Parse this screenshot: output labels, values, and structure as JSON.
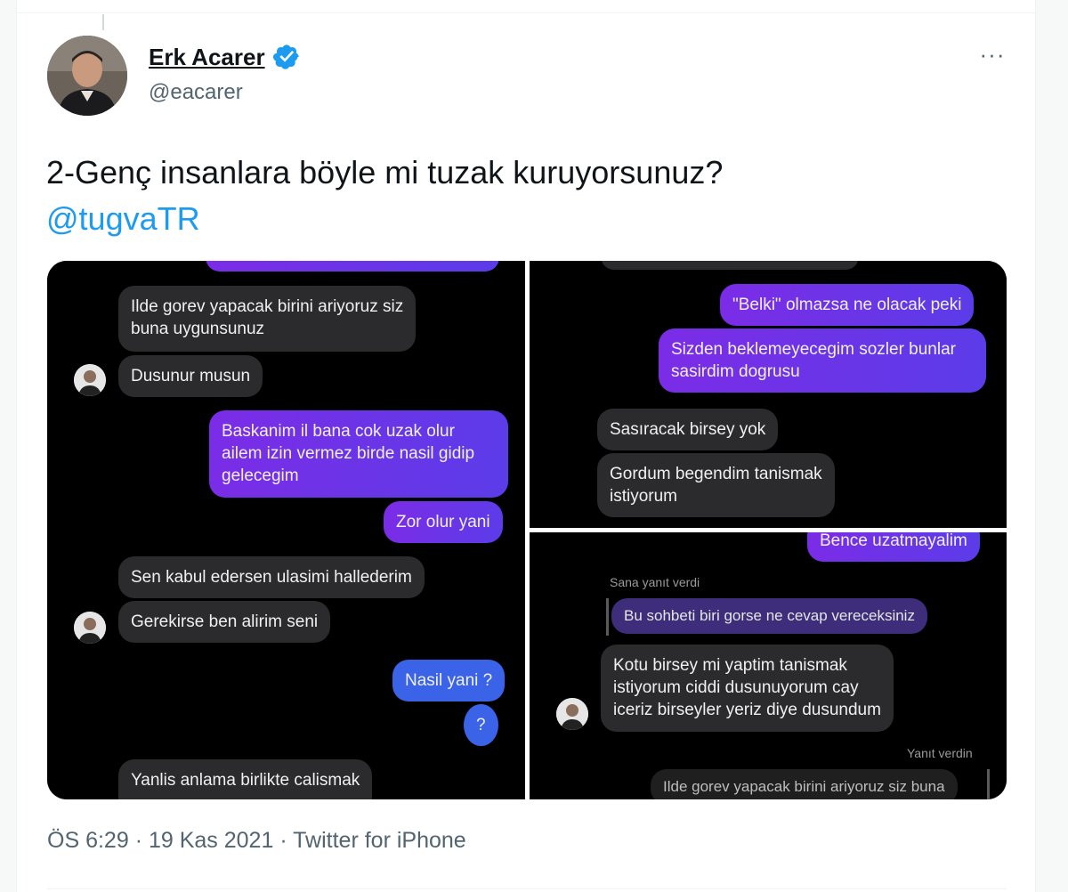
{
  "tweet": {
    "author_name": "Erk Acarer",
    "author_handle": "@eacarer",
    "more_label": "···",
    "text": "2-Genç insanlara böyle mi tuzak kuruyorsunuz?",
    "mention": "@tugvaTR",
    "time": "ÖS 6:29",
    "date": "19 Kas 2021",
    "source": "Twitter for iPhone",
    "separator": "·"
  },
  "media": {
    "panel_left": {
      "messages": [
        {
          "side": "in",
          "text": "Ilde gorev yapacak birini ariyoruz siz\nbuna uygunsunuz"
        },
        {
          "side": "in",
          "text": "Dusunur musun"
        },
        {
          "side": "out",
          "text": "Baskanim il bana cok uzak olur\nailem izin vermez birde nasil gidip\ngelecegim"
        },
        {
          "side": "out",
          "text": "Zor olur yani"
        },
        {
          "side": "in",
          "text": "Sen kabul edersen ulasimi hallederim"
        },
        {
          "side": "in",
          "text": "Gerekirse ben alirim seni"
        },
        {
          "side": "out",
          "text": "Nasil yani ?"
        },
        {
          "side": "out",
          "text": "?"
        },
        {
          "side": "in",
          "text": "Yanlis anlama birlikte calismak"
        }
      ]
    },
    "panel_top_right": {
      "messages": [
        {
          "side": "out",
          "text": "\"Belki\" olmazsa ne olacak peki"
        },
        {
          "side": "out",
          "text": "Sizden beklemeyecegim sozler bunlar\nsasirdim dogrusu"
        },
        {
          "side": "in",
          "text": "Sasıracak birsey yok"
        },
        {
          "side": "in",
          "text": "Gordum begendim tanismak\nistiyorum"
        }
      ]
    },
    "panel_bottom_right": {
      "messages": [
        {
          "side": "out",
          "text": "Bence uzatmayalim"
        },
        {
          "side": "meta",
          "text": "Sana yanıt verdi"
        },
        {
          "side": "quote",
          "text": "Bu sohbeti biri gorse ne cevap vereceksiniz"
        },
        {
          "side": "in",
          "text": "Kotu birsey mi yaptim tanismak\nistiyorum ciddi dusunuyorum cay\niceriz birseyler yeriz diye dusundum"
        },
        {
          "side": "meta",
          "text": "Yanıt verdin"
        },
        {
          "side": "quote",
          "text": "Ilde gorev yapacak birini ariyoruz siz buna"
        }
      ]
    }
  },
  "colors": {
    "accent": "#1d9bf0",
    "text_primary": "#0f1419",
    "text_secondary": "#536471",
    "bubble_incoming": "#2b2b2d",
    "bubble_outgoing": "#6a34e8"
  },
  "icons": [
    "verified-badge-icon",
    "more-options-icon"
  ]
}
